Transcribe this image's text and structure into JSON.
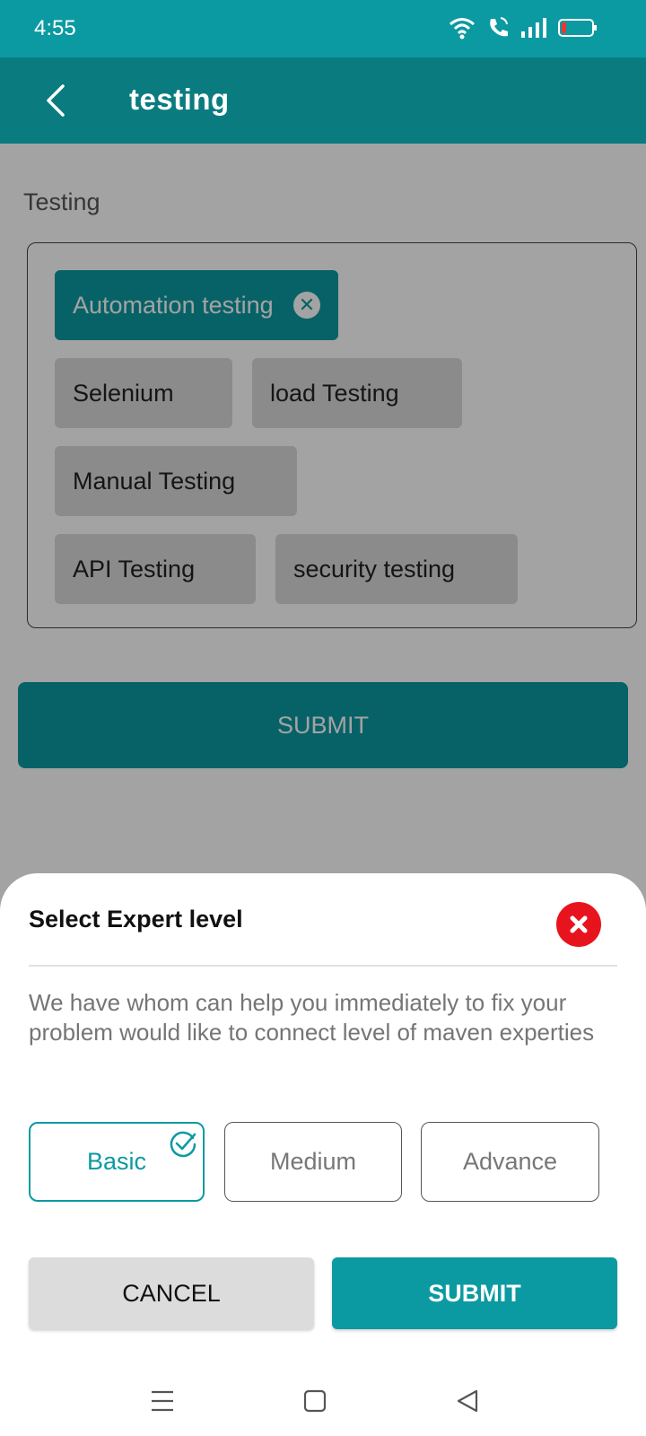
{
  "status_bar": {
    "time": "4:55",
    "icons": [
      "wifi-icon",
      "wifi-call-icon",
      "signal-icon",
      "battery-low-icon"
    ]
  },
  "app_bar": {
    "title": "testing",
    "back_icon": "back-arrow-icon"
  },
  "main": {
    "section_label": "Testing",
    "chips": [
      {
        "label": "Automation testing",
        "selected": true
      },
      {
        "label": "Selenium",
        "selected": false
      },
      {
        "label": "load Testing",
        "selected": false
      },
      {
        "label": "Manual Testing",
        "selected": false
      },
      {
        "label": "API Testing",
        "selected": false
      },
      {
        "label": "security testing",
        "selected": false
      }
    ],
    "submit_label": "SUBMIT"
  },
  "sheet": {
    "title": "Select Expert level",
    "description": "We have whom can help you immediately to fix your problem would like to connect level of maven experties",
    "levels": [
      {
        "label": "Basic",
        "selected": true
      },
      {
        "label": "Medium",
        "selected": false
      },
      {
        "label": "Advance",
        "selected": false
      }
    ],
    "cancel_label": "CANCEL",
    "submit_label": "SUBMIT"
  },
  "colors": {
    "primary": "#0b9aa1",
    "app_bar": "#0a7c80",
    "close_red": "#e8141d"
  }
}
